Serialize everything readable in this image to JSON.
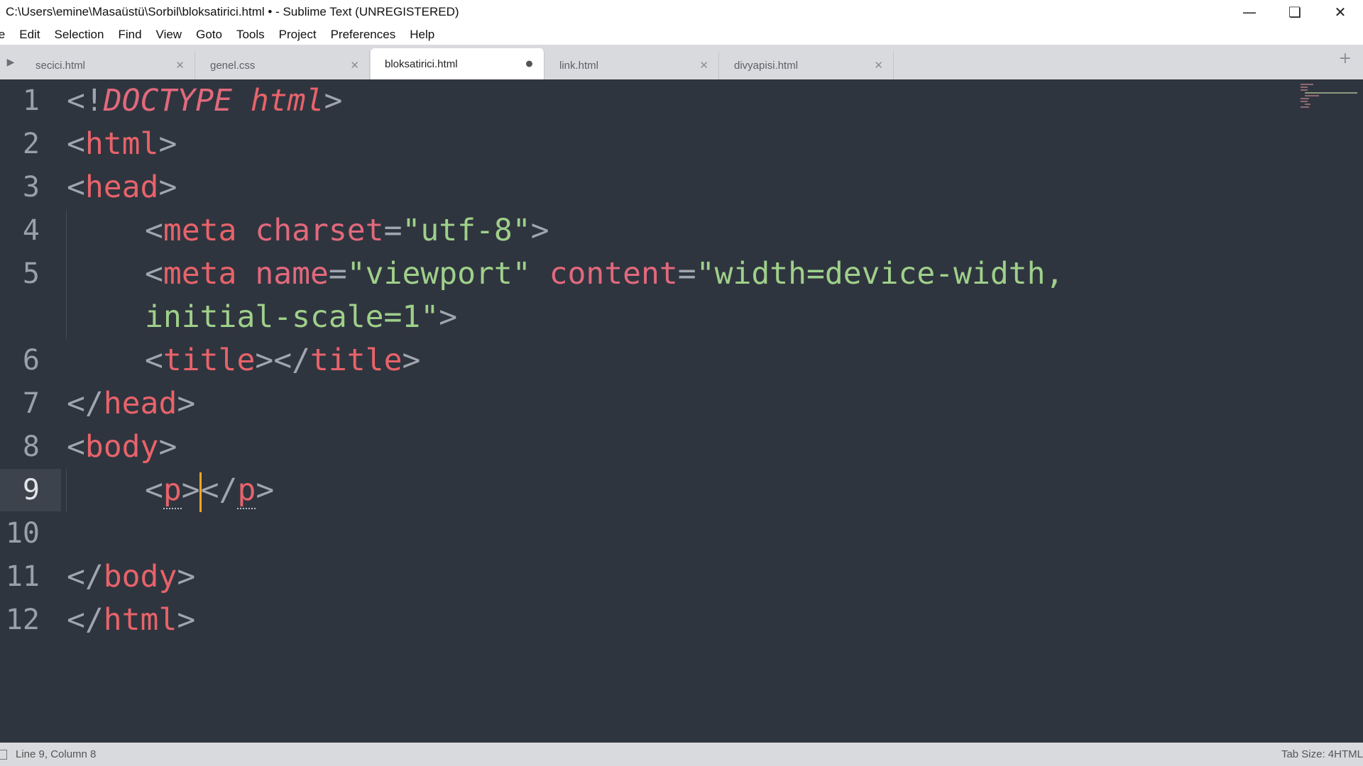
{
  "window": {
    "title": "C:\\Users\\emine\\Masaüstü\\Sorbil\\bloksatirici.html • - Sublime Text (UNREGISTERED)",
    "controls": [
      "minimize-icon",
      "restore-icon",
      "close-icon"
    ]
  },
  "menu": {
    "items": [
      "le",
      "Edit",
      "Selection",
      "Find",
      "View",
      "Goto",
      "Tools",
      "Project",
      "Preferences",
      "Help"
    ]
  },
  "tabs": [
    {
      "label": "secici.html",
      "active": false
    },
    {
      "label": "genel.css",
      "active": false
    },
    {
      "label": "bloksatirici.html",
      "active": true,
      "dirty": true
    },
    {
      "label": "link.html",
      "active": false
    },
    {
      "label": "divyapisi.html",
      "active": false
    }
  ],
  "editor": {
    "current_line": 9,
    "line_numbers": [
      "1",
      "2",
      "3",
      "4",
      "5",
      "",
      "6",
      "7",
      "8",
      "9",
      "10",
      "11",
      "12"
    ],
    "lines": {
      "l1": {
        "open": "<!",
        "kw": "DOCTYPE",
        "sp": " ",
        "val": "html",
        "close": ">"
      },
      "l2": {
        "open": "<",
        "tag": "html",
        "close": ">"
      },
      "l3": {
        "open": "<",
        "tag": "head",
        "close": ">"
      },
      "l4": {
        "open": "<",
        "tag": "meta",
        "attr": "charset",
        "eq": "=",
        "str": "\"utf-8\"",
        "close": ">"
      },
      "l5": {
        "open": "<",
        "tag": "meta",
        "attr1": "name",
        "eq1": "=",
        "str1": "\"viewport\"",
        "attr2": "content",
        "eq2": "=",
        "str2": "\"width=device-width,"
      },
      "l5b": {
        "str": "initial-scale=1\"",
        "close": ">"
      },
      "l6": {
        "open": "<",
        "tag": "title",
        "mid": "></",
        "tag2": "title",
        "close": ">"
      },
      "l7": {
        "open": "</",
        "tag": "head",
        "close": ">"
      },
      "l8": {
        "open": "<",
        "tag": "body",
        "close": ">"
      },
      "l9": {
        "open": "<",
        "tag": "p",
        "mid1": ">",
        "mid2": "</",
        "tag2": "p",
        "close": ">"
      },
      "l11": {
        "open": "</",
        "tag": "body",
        "close": ">"
      },
      "l12": {
        "open": "</",
        "tag": "html",
        "close": ">"
      }
    }
  },
  "status": {
    "position": "Line 9, Column 8",
    "tab_size": "Tab Size: 4",
    "syntax": "HTML"
  }
}
